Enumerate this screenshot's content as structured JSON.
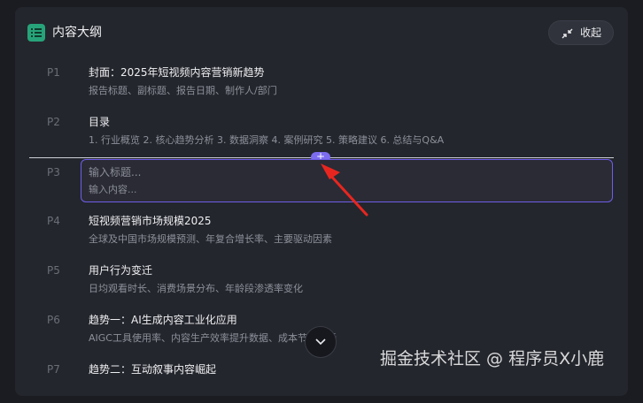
{
  "header": {
    "title": "内容大纲",
    "collapse_label": "收起"
  },
  "items": [
    {
      "num": "P1",
      "title": "封面：2025年短视频内容营销新趋势",
      "desc": "报告标题、副标题、报告日期、制作人/部门"
    },
    {
      "num": "P2",
      "title": "目录",
      "desc": "1. 行业概览 2. 核心趋势分析 3. 数据洞察 4. 案例研究 5. 策略建议 6. 总结与Q&A"
    },
    {
      "num": "P3"
    },
    {
      "num": "P4",
      "title": "短视频营销市场规模2025",
      "desc": "全球及中国市场规模预测、年复合增长率、主要驱动因素"
    },
    {
      "num": "P5",
      "title": "用户行为变迁",
      "desc": "日均观看时长、消费场景分布、年龄段渗透率变化"
    },
    {
      "num": "P6",
      "title": "趋势一：AI生成内容工业化应用",
      "desc": "AIGC工具使用率、内容生产效率提升数据、成本节约分析"
    },
    {
      "num": "P7",
      "title": "趋势二：互动叙事内容崛起"
    }
  ],
  "editor": {
    "title_placeholder": "输入标题...",
    "content_placeholder": "输入内容..."
  },
  "insert_symbol": "+",
  "watermark": "掘金技术社区 @ 程序员X小鹿",
  "colors": {
    "accent": "#7b6cf0",
    "icon_green": "#27a37a",
    "arrow_red": "#e8261f"
  }
}
